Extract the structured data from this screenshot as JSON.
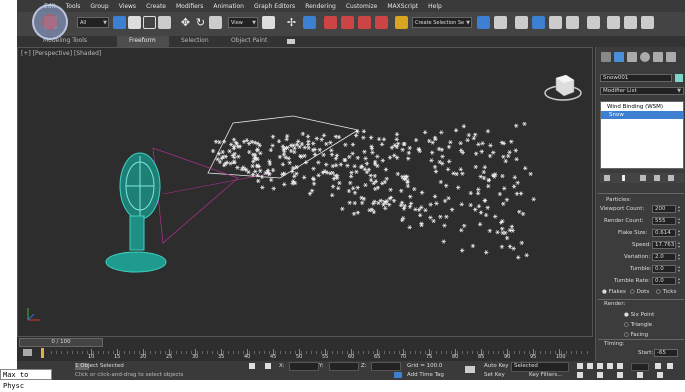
{
  "menu": [
    "Edit",
    "Tools",
    "Group",
    "Views",
    "Create",
    "Modifiers",
    "Animation",
    "Graph Editors",
    "Rendering",
    "Customize",
    "MAXScript",
    "Help"
  ],
  "toolbar": {
    "filter_value": "All",
    "ref_coord_value": "View",
    "selection_set_value": "Create Selection Se"
  },
  "ribbon": {
    "tabs": [
      "Modeling Tools",
      "Freeform",
      "Selection",
      "Object Paint"
    ],
    "active": "Freeform"
  },
  "viewport": {
    "label": "[+] [Perspective] [Shaded]"
  },
  "command_panel": {
    "object_name": "Snow001",
    "modifier_list_label": "Modifier List",
    "stack": [
      "Wind Binding (WSM)",
      "Snow"
    ],
    "section_particles": "Particles:",
    "params": [
      {
        "label": "Viewport Count:",
        "value": "200"
      },
      {
        "label": "Render Count:",
        "value": "555"
      },
      {
        "label": "Flake Size:",
        "value": "0.614"
      },
      {
        "label": "Speed:",
        "value": "17.763"
      },
      {
        "label": "Variation:",
        "value": "2.0"
      },
      {
        "label": "Tumble:",
        "value": "0.0"
      },
      {
        "label": "Tumble Rate:",
        "value": "0.0"
      }
    ],
    "display_options": [
      "Flakes",
      "Dots",
      "Ticks"
    ],
    "display_selected": "Flakes",
    "section_render": "Render:",
    "render_options": [
      "Six Point",
      "Triangle",
      "Facing"
    ],
    "render_selected": "Six Point",
    "section_timing": "Timing:",
    "start_label": "Start:",
    "start_value": "-65"
  },
  "timeline": {
    "slider_label": "0 / 100",
    "ticks": [
      "10",
      "15",
      "20",
      "25",
      "30",
      "35",
      "40",
      "45",
      "50",
      "55",
      "60",
      "65",
      "70",
      "75",
      "80",
      "85",
      "90",
      "95",
      "100"
    ]
  },
  "status": {
    "maxscript": "Max to Physc",
    "selected_text": "1 Object Selected",
    "prompt_text": "Click or click-and-drag to select objects",
    "grid_text": "Grid = 100.0",
    "add_time_tag": "Add Time Tag",
    "auto_key": "Auto Key",
    "key_mode_value": "Selected",
    "set_key": "Set Key",
    "key_filters": "Key Filters..."
  }
}
